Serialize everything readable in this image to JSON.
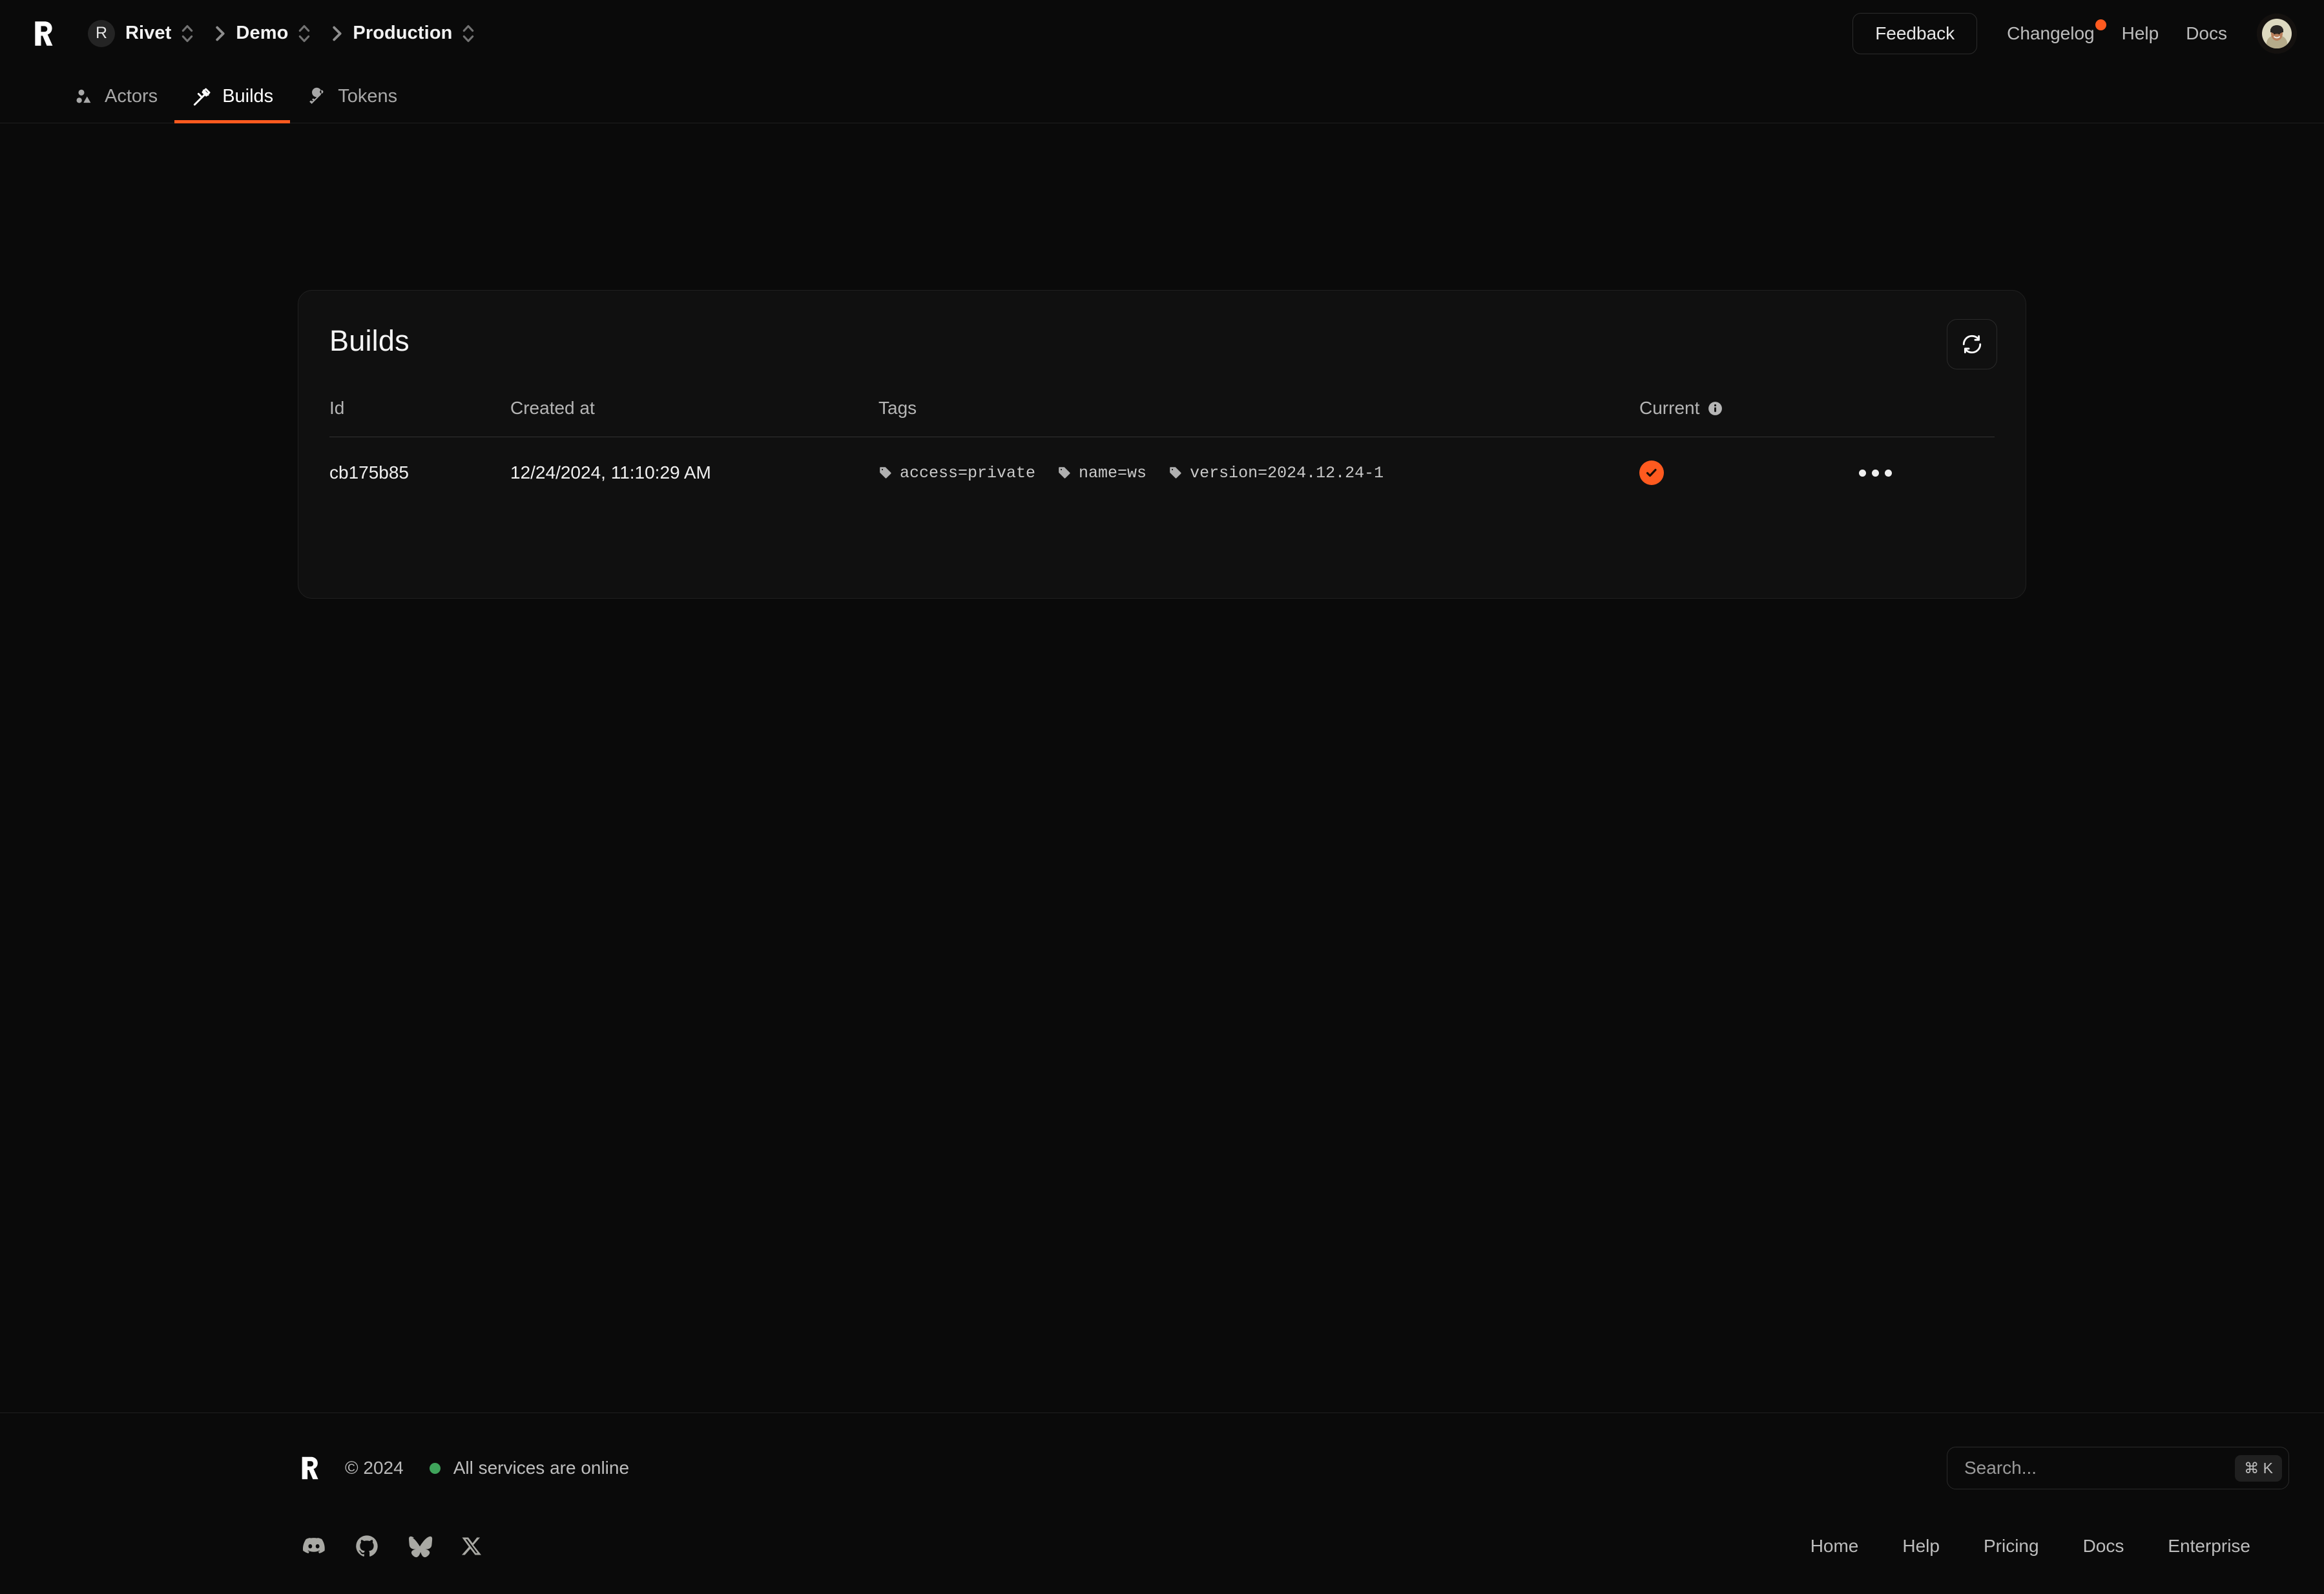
{
  "header": {
    "logo_icon": "rivet-logo-icon",
    "breadcrumb": {
      "org_initial": "R",
      "org": "Rivet",
      "project": "Demo",
      "environment": "Production",
      "separator_icon": "chevron-right-icon",
      "selector_icon": "chevron-up-down-icon"
    },
    "feedback_label": "Feedback",
    "changelog_label": "Changelog",
    "help_label": "Help",
    "docs_label": "Docs",
    "avatar_name": "user-avatar"
  },
  "tabs": [
    {
      "label": "Actors",
      "icon": "actors-icon",
      "active": false
    },
    {
      "label": "Builds",
      "icon": "hammer-icon",
      "active": true
    },
    {
      "label": "Tokens",
      "icon": "key-icon",
      "active": false
    }
  ],
  "card": {
    "title": "Builds",
    "refresh_icon": "refresh-icon",
    "columns": {
      "id": "Id",
      "created_at": "Created at",
      "tags": "Tags",
      "current": "Current",
      "current_info_icon": "info-icon"
    },
    "rows": [
      {
        "id": "cb175b85",
        "created_at": "12/24/2024, 11:10:29 AM",
        "tags": [
          "access=private",
          "name=ws",
          "version=2024.12.24-1"
        ],
        "tag_icon": "tag-icon",
        "current": true,
        "current_icon": "check-circle-icon",
        "menu_icon": "ellipsis-icon"
      }
    ]
  },
  "footer": {
    "logo_icon": "rivet-logo-icon",
    "copyright": "© 2024",
    "status_text": "All services are online",
    "status_color": "#3fa45b",
    "search": {
      "placeholder": "Search...",
      "shortcut": "⌘ K"
    },
    "socials": [
      {
        "name": "discord-icon"
      },
      {
        "name": "github-icon"
      },
      {
        "name": "bluesky-icon"
      },
      {
        "name": "x-icon"
      }
    ],
    "links": [
      "Home",
      "Help",
      "Pricing",
      "Docs",
      "Enterprise"
    ]
  },
  "colors": {
    "accent": "#ff5a1f",
    "page_bg": "#0a0a0a",
    "card_bg": "#101010",
    "border": "#202020"
  }
}
